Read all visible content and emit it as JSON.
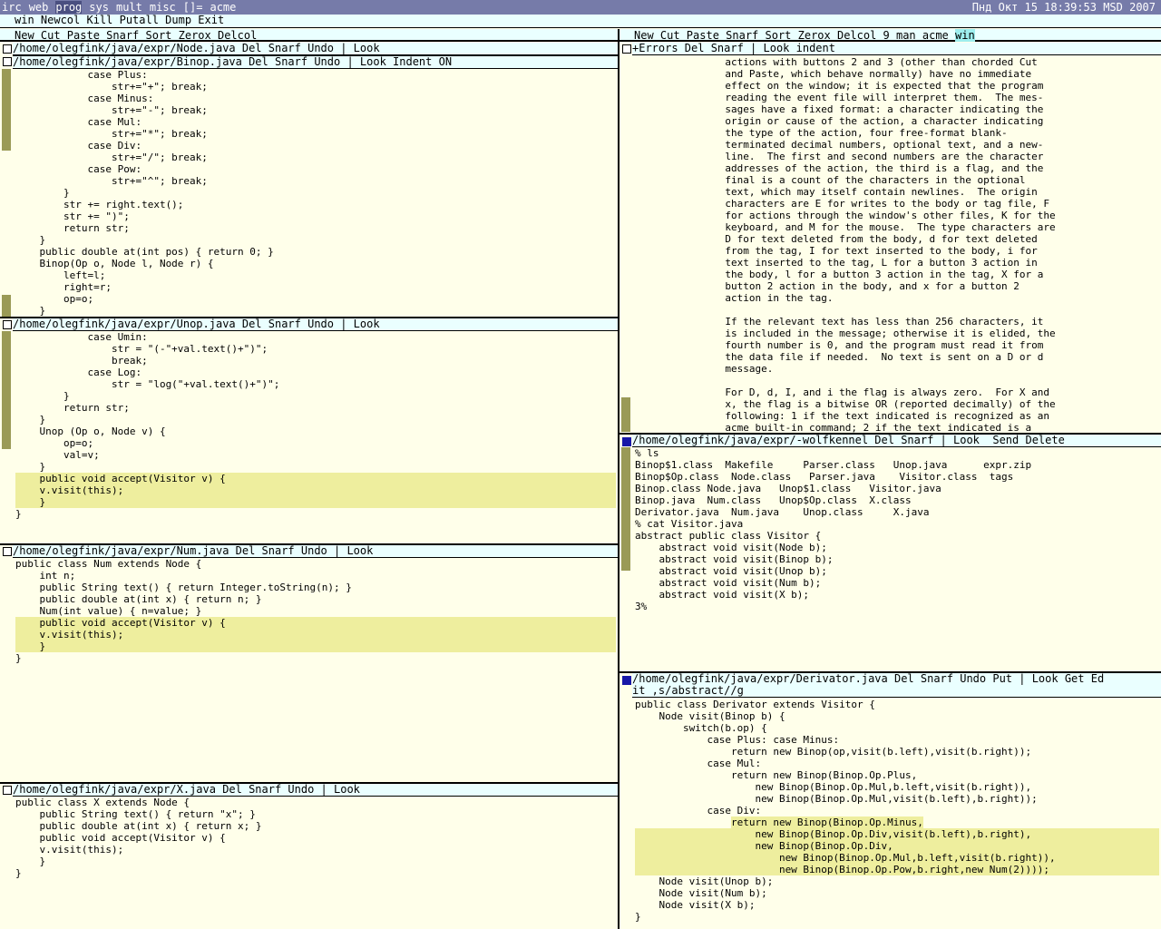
{
  "topbar": {
    "workspaces": [
      "irc",
      "web",
      "prog",
      "sys",
      "mult",
      "misc",
      "[]=",
      "acme"
    ],
    "active_workspace": "prog",
    "clock": "Пнд Окт 15 18:39:53 MSD 2007"
  },
  "acme_tag": "win Newcol Kill Putall Dump Exit",
  "col1": {
    "tag": "New Cut Paste Snarf Sort Zerox Delcol",
    "node_tag": "/home/olegfink/java/expr/Node.java Del Snarf Undo | Look",
    "binop": {
      "tag": "/home/olegfink/java/expr/Binop.java Del Snarf Undo | Look Indent ON",
      "lines": [
        "            case Plus:",
        "                str+=\"+\"; break;",
        "            case Minus:",
        "                str+=\"-\"; break;",
        "            case Mul:",
        "                str+=\"*\"; break;",
        "            case Div:",
        "                str+=\"/\"; break;",
        "            case Pow:",
        "                str+=\"^\"; break;",
        "        }",
        "        str += right.text();",
        "        str += \")\";",
        "        return str;",
        "    }",
        "    public double at(int pos) { return 0; }",
        "    Binop(Op o, Node l, Node r) {",
        "        left=l;",
        "        right=r;",
        "        op=o;",
        "    }"
      ]
    },
    "unop": {
      "tag": "/home/olegfink/java/expr/Unop.java Del Snarf Undo | Look",
      "lines": [
        "            case Umin:",
        "                str = \"(-\"+val.text()+\")\";",
        "                break;",
        "            case Log:",
        "                str = \"log(\"+val.text()+\")\";",
        "        }",
        "        return str;",
        "    }",
        "    Unop (Op o, Node v) {",
        "        op=o;",
        "        val=v;",
        "    }"
      ],
      "highlighted": [
        "    public void accept(Visitor v) {",
        "    v.visit(this);",
        "    }"
      ],
      "after": [
        "}"
      ]
    },
    "num": {
      "tag": "/home/olegfink/java/expr/Num.java Del Snarf Undo | Look",
      "lines": [
        "public class Num extends Node {",
        "    int n;",
        "    public String text() { return Integer.toString(n); }",
        "    public double at(int x) { return n; }",
        "    Num(int value) { n=value; }"
      ],
      "highlighted": [
        "    public void accept(Visitor v) {",
        "    v.visit(this);",
        "    }"
      ],
      "after": [
        "}"
      ]
    },
    "x": {
      "tag": "/home/olegfink/java/expr/X.java Del Snarf Undo | Look",
      "lines": [
        "public class X extends Node {",
        "    public String text() { return \"x\"; }",
        "    public double at(int x) { return x; }",
        "    public void accept(Visitor v) {",
        "    v.visit(this);",
        "    }",
        "}"
      ]
    }
  },
  "col2": {
    "tag_before": "New Cut Paste Snarf Sort Zerox Delcol 9 man acme ",
    "tag_highlight": "win",
    "errors": {
      "tag": "+Errors Del Snarf | Look indent",
      "lines": [
        "               actions with buttons 2 and 3 (other than chorded Cut",
        "               and Paste, which behave normally) have no immediate",
        "               effect on the window; it is expected that the program",
        "               reading the event file will interpret them.  The mes-",
        "               sages have a fixed format: a character indicating the",
        "               origin or cause of the action, a character indicating",
        "               the type of the action, four free-format blank-",
        "               terminated decimal numbers, optional text, and a new-",
        "               line.  The first and second numbers are the character",
        "               addresses of the action, the third is a flag, and the",
        "               final is a count of the characters in the optional",
        "               text, which may itself contain newlines.  The origin",
        "               characters are E for writes to the body or tag file, F",
        "               for actions through the window's other files, K for the",
        "               keyboard, and M for the mouse.  The type characters are",
        "               D for text deleted from the body, d for text deleted",
        "               from the tag, I for text inserted to the body, i for",
        "               text inserted to the tag, L for a button 3 action in",
        "               the body, l for a button 3 action in the tag, X for a",
        "               button 2 action in the body, and x for a button 2",
        "               action in the tag.",
        "",
        "               If the relevant text has less than 256 characters, it",
        "               is included in the message; otherwise it is elided, the",
        "               fourth number is 0, and the program must read it from",
        "               the data file if needed.  No text is sent on a D or d",
        "               message.",
        "",
        "               For D, d, I, and i the flag is always zero.  For X and",
        "               x, the flag is a bitwise OR (reported decimally) of the",
        "               following: 1 if the text indicated is recognized as an",
        "               acme built-in command; 2 if the text indicated is a"
      ]
    },
    "shell": {
      "tag": "/home/olegfink/java/expr/-wolfkennel Del Snarf | Look  Send Delete",
      "lines": [
        "% ls",
        "Binop$1.class  Makefile     Parser.class   Unop.java      expr.zip",
        "Binop$Op.class  Node.class   Parser.java    Visitor.class  tags",
        "Binop.class Node.java   Unop$1.class   Visitor.java",
        "Binop.java  Num.class   Unop$Op.class  X.class",
        "Derivator.java  Num.java    Unop.class     X.java",
        "% cat Visitor.java",
        "abstract public class Visitor {",
        "    abstract void visit(Node b);",
        "    abstract void visit(Binop b);",
        "    abstract void visit(Unop b);",
        "    abstract void visit(Num b);",
        "    abstract void visit(X b);",
        "3% "
      ]
    },
    "derivator": {
      "tag_line1": "/home/olegfink/java/expr/Derivator.java Del Snarf Undo Put | Look Get Ed",
      "tag_line2": "it ,s/abstract//g",
      "lines": [
        "public class Derivator extends Visitor {",
        "    Node visit(Binop b) {",
        "        switch(b.op) {",
        "            case Plus: case Minus:",
        "                return new Binop(op,visit(b.left),visit(b.right));",
        "            case Mul:",
        "                return new Binop(Binop.Op.Plus,",
        "                    new Binop(Binop.Op.Mul,b.left,visit(b.right)),",
        "                    new Binop(Binop.Op.Mul,visit(b.left),b.right));",
        "            case Div:"
      ],
      "hl_first_indent": "                ",
      "hl_first": "return new Binop(Binop.Op.Minus,",
      "highlighted": [
        "                    new Binop(Binop.Op.Div,visit(b.left),b.right),",
        "                    new Binop(Binop.Op.Div,",
        "                        new Binop(Binop.Op.Mul,b.left,visit(b.right)),",
        "                        new Binop(Binop.Op.Pow,b.right,new Num(2))));"
      ],
      "after": [
        "    Node visit(Unop b);",
        "    Node visit(Num b);",
        "    Node visit(X b);",
        "}"
      ]
    }
  }
}
